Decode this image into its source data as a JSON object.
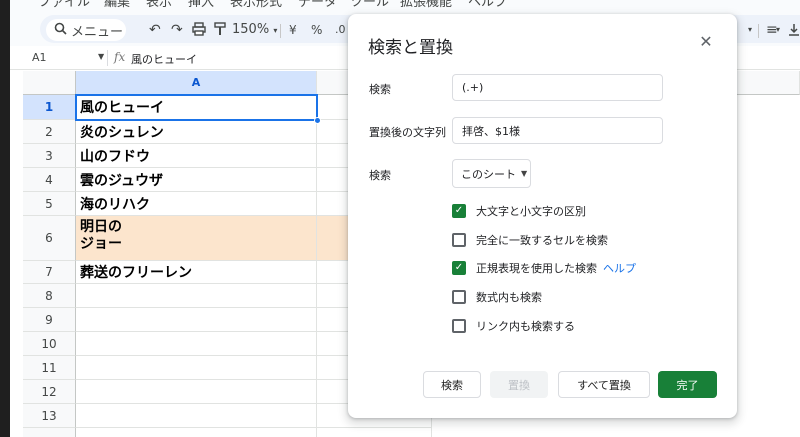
{
  "menu": {
    "items": [
      "ファイル",
      "編集",
      "表示",
      "挿入",
      "表示形式",
      "データ",
      "ツール",
      "拡張機能",
      "ヘルプ"
    ]
  },
  "toolbar": {
    "search_label": "メニュー",
    "zoom": "150%",
    "currency": "¥",
    "percent": "%",
    "decimal": ".0",
    "align_icon": "≡"
  },
  "formula_bar": {
    "cell_ref": "A1",
    "fx": "fx",
    "value": "風のヒューイ"
  },
  "grid": {
    "columns": [
      "A"
    ],
    "rows": [
      "1",
      "2",
      "3",
      "4",
      "5",
      "6",
      "7",
      "8",
      "9",
      "10",
      "11",
      "12",
      "13"
    ],
    "cells": [
      "風のヒューイ",
      "炎のシュレン",
      "山のフドウ",
      "雲のジュウザ",
      "海のリハク",
      "明日の\nジョー",
      "葬送のフリーレン"
    ],
    "highlight_color": "#fce5cd",
    "selection_color": "#1a73e8"
  },
  "dialog": {
    "title": "検索と置換",
    "close_icon": "✕",
    "find_label": "検索",
    "find_value": "(.+)",
    "replace_label": "置換後の文字列",
    "replace_value": "拝啓、$1様",
    "scope_label": "検索",
    "scope_value": "このシート",
    "options": [
      {
        "label": "大文字と小文字の区別",
        "checked": true
      },
      {
        "label": "完全に一致するセルを検索",
        "checked": false
      },
      {
        "label": "正規表現を使用した検索",
        "checked": true,
        "link": "ヘルプ"
      },
      {
        "label": "数式内も検索",
        "checked": false
      },
      {
        "label": "リンク内も検索する",
        "checked": false
      }
    ],
    "buttons": {
      "find": "検索",
      "replace": "置換",
      "replace_all": "すべて置換",
      "done": "完了"
    },
    "accent_color": "#188038"
  }
}
